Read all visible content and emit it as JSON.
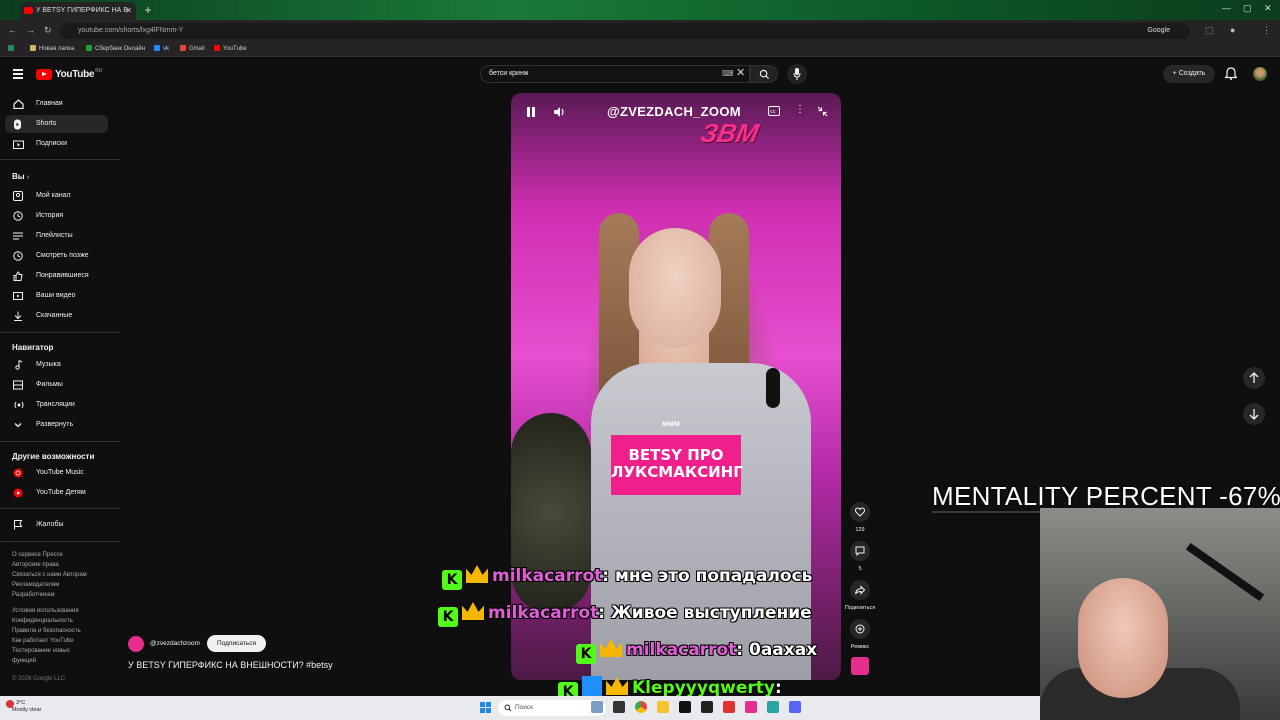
{
  "browser": {
    "tab_title": "У BETSY ГИПЕРФИКС НА В",
    "url": "youtube.com/shorts/lxg4lFNmm-Y",
    "search_engine_chip": "Google",
    "bookmarks": [
      "Новая лапка",
      "Сбербанк Онлайн",
      "vk",
      "Gmail",
      "YouTube"
    ]
  },
  "header": {
    "logo_text": "YouTube",
    "logo_region": "RU",
    "search_query": "бетси кринж",
    "create_label": "Создать"
  },
  "sidebar": {
    "main": [
      {
        "label": "Главная",
        "icon": "home-icon"
      },
      {
        "label": "Shorts",
        "icon": "shorts-icon"
      },
      {
        "label": "Подписки",
        "icon": "subscriptions-icon"
      }
    ],
    "you_header": "Вы",
    "you_items": [
      "Мой канал",
      "История",
      "Плейлисты",
      "Смотреть позже",
      "Понравившиеся",
      "Ваши видео",
      "Скачанные"
    ],
    "navigator_header": "Навигатор",
    "navigator_items": [
      "Музыка",
      "Фильмы",
      "Трансляции",
      "Развернуть"
    ],
    "other_header": "Другие возможности",
    "other_items": [
      "YouTube Music",
      "YouTube Детям"
    ],
    "report": "Жалобы",
    "footer_lines_1": [
      "О сервисе  Прессе",
      "Авторские права",
      "Связаться с нами  Авторам",
      "Рекламодателям",
      "Разработчикам"
    ],
    "footer_lines_2": [
      "Условия использования",
      "Конфиденциальность",
      "Правила и безопасность",
      "Как работает YouTube",
      "Тестирование новых",
      "функций"
    ],
    "copyright": "© 2026 Google LLC"
  },
  "short": {
    "watermark": "@ZVEZDACH_ZOOM",
    "logo": "ЗВМ",
    "caption_small": "ммм",
    "title_card_1": "BETSY ПРО",
    "title_card_2": "ЛУКСМАКСИНГ",
    "channel": "@zvezdachzoom",
    "subscribe_label": "Подписаться",
    "title": "У BETSY ГИПЕРФИКС НА ВНЕШНОСТИ? #betsy"
  },
  "actions": {
    "likes": "129",
    "comments": "5",
    "share_label": "Поделиться",
    "remix_label": "Ремикс"
  },
  "overlay": {
    "mentality": "MENTALITY PERCENT -67%",
    "chat": [
      {
        "user": "milkacarrot",
        "msg": ": мне это попадалось"
      },
      {
        "user": "milkacarrot",
        "msg": ": Живое выступление"
      },
      {
        "user": "milkacarrot",
        "msg": ": 0аахах"
      },
      {
        "user": "Klepyyyqwerty",
        "msg": ":"
      }
    ]
  },
  "taskbar": {
    "weather_temp": "3°C",
    "weather_desc": "Mostly clear",
    "search_placeholder": "Поиск"
  }
}
